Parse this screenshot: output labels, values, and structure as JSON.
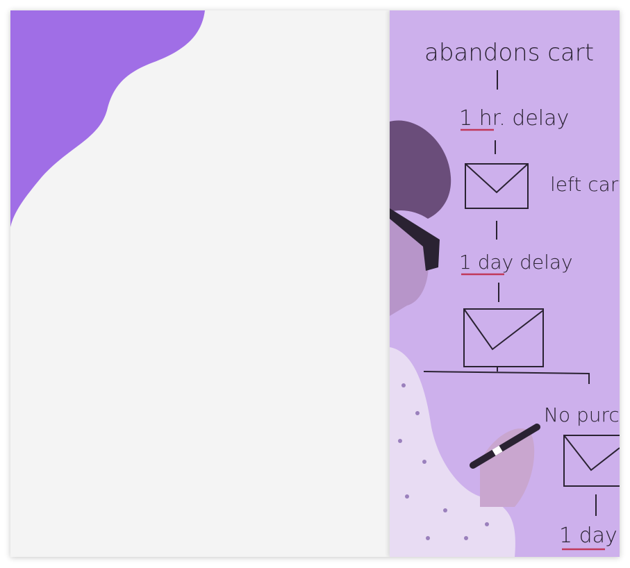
{
  "colors": {
    "accent": "#a06ee6",
    "panel_background": "#f4f4f4",
    "image_tint": "#cdb0ec"
  },
  "hero_image": {
    "whiteboard": {
      "step1": "abandons cart",
      "step2": "1 hr. delay",
      "email1_label": "left cart",
      "step3": "1 day delay",
      "branch_label": "No purch",
      "step4": "1 day"
    }
  }
}
